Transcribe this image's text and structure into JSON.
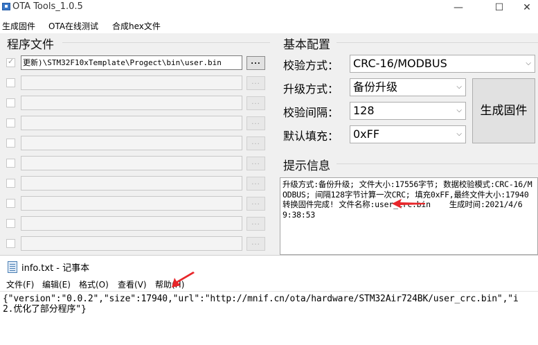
{
  "app": {
    "title": "OTA Tools_1.0.5",
    "icon": "ota-app-icon",
    "window_controls": [
      "—",
      "☐",
      "✕"
    ],
    "menu": [
      "生成固件",
      "OTA在线测试",
      "合成hex文件"
    ]
  },
  "program_files": {
    "title": "程序文件",
    "rows": [
      {
        "checked": true,
        "path": "更新)\\STM32F10xTemplate\\Progect\\bin\\user.bin",
        "browse": "..."
      },
      {
        "checked": false,
        "path": "",
        "browse": "..."
      },
      {
        "checked": false,
        "path": "",
        "browse": "..."
      },
      {
        "checked": false,
        "path": "",
        "browse": "..."
      },
      {
        "checked": false,
        "path": "",
        "browse": "..."
      },
      {
        "checked": false,
        "path": "",
        "browse": "..."
      },
      {
        "checked": false,
        "path": "",
        "browse": "..."
      },
      {
        "checked": false,
        "path": "",
        "browse": "..."
      },
      {
        "checked": false,
        "path": "",
        "browse": "..."
      },
      {
        "checked": false,
        "path": "",
        "browse": "..."
      }
    ]
  },
  "config": {
    "title": "基本配置",
    "checksum": {
      "label": "校验方式：",
      "value": "CRC-16/MODBUS"
    },
    "upgrade": {
      "label": "升级方式：",
      "value": "备份升级"
    },
    "interval": {
      "label": "校验间隔：",
      "value": "128"
    },
    "fill": {
      "label": "默认填充：",
      "value": "0xFF"
    },
    "generate_button": "生成固件"
  },
  "info": {
    "title": "提示信息",
    "text": "升级方式:备份升级; 文件大小:17556字节; 数据校验模式:CRC-16/MODBUS; 间隔128字节计算一次CRC; 填充0xFF,最终文件大小:17940\n转换固件完成! 文件名称:user_crc.bin    生成时间:2021/4/6 9:38:53"
  },
  "notepad": {
    "title": "info.txt - 记事本",
    "icon": "notepad-icon",
    "menu": [
      "文件(F)",
      "编辑(E)",
      "格式(O)",
      "查看(V)",
      "帮助(H)"
    ],
    "content": "{\"version\":\"0.0.2\",\"size\":17940,\"url\":\"http://mnif.cn/ota/hardware/STM32Air724BK/user_crc.bin\",\"i\n2.优化了部分程序\"}"
  },
  "colors": {
    "window_bg": "#f0f0f0",
    "annotation_arrow": "#e8262a"
  }
}
